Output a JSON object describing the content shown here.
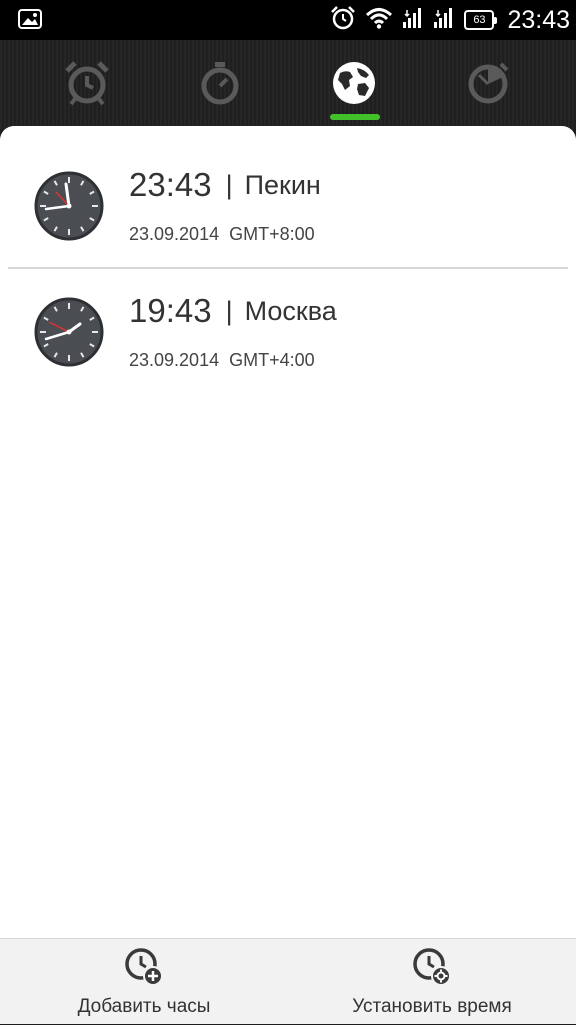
{
  "status_bar": {
    "time": "23:43",
    "battery": "63",
    "icons": [
      "image-icon",
      "alarm-icon",
      "wifi-icon",
      "signal-icon",
      "signal-icon",
      "battery-icon"
    ]
  },
  "tabs": [
    {
      "name": "alarm-clock-icon",
      "active": false
    },
    {
      "name": "stopwatch-icon",
      "active": false
    },
    {
      "name": "world-clock-icon",
      "active": true
    },
    {
      "name": "timer-icon",
      "active": false
    }
  ],
  "accent_color": "#42c02a",
  "clocks": [
    {
      "time": "23:43",
      "separator": "|",
      "city": "Пекин",
      "date": "23.09.2014",
      "gmt": "GMT+8:00"
    },
    {
      "time": "19:43",
      "separator": "|",
      "city": "Москва",
      "date": "23.09.2014",
      "gmt": "GMT+4:00"
    }
  ],
  "bottom_bar": {
    "add_clock": "Добавить часы",
    "set_time": "Установить время"
  }
}
